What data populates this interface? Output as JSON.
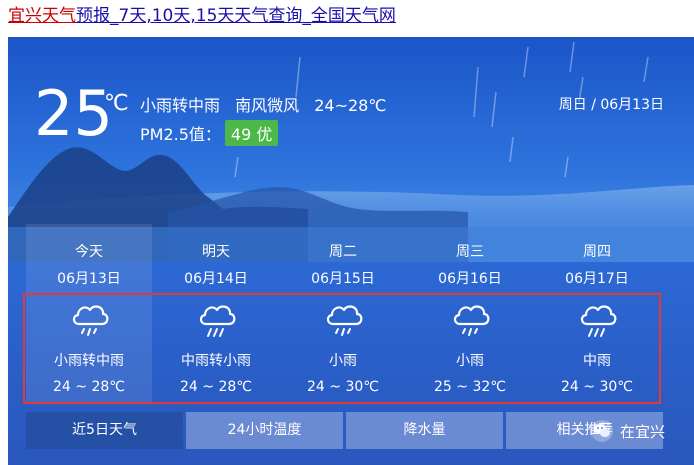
{
  "page_link": {
    "red_part": "宜兴天气",
    "blue_part": "预报_7天,10天,15天天气查询_全国天气网"
  },
  "current": {
    "temp": "25",
    "unit": "℃",
    "condition": "小雨转中雨",
    "wind": "南风微风",
    "range": "24~28℃",
    "pm_label": "PM2.5值：",
    "aqi": "49 优",
    "date": "周日 / 06月13日"
  },
  "forecast": [
    {
      "name": "今天",
      "date": "06月13日",
      "icon": "rain-cloud-icon",
      "condition": "小雨转中雨",
      "range": "24 ~ 28℃"
    },
    {
      "name": "明天",
      "date": "06月14日",
      "icon": "rain-cloud-icon",
      "condition": "中雨转小雨",
      "range": "24 ~ 28℃"
    },
    {
      "name": "周二",
      "date": "06月15日",
      "icon": "rain-cloud-icon",
      "condition": "小雨",
      "range": "24 ~ 30℃"
    },
    {
      "name": "周三",
      "date": "06月16日",
      "icon": "rain-cloud-icon",
      "condition": "小雨",
      "range": "25 ~ 32℃"
    },
    {
      "name": "周四",
      "date": "06月17日",
      "icon": "rain-cloud-icon",
      "condition": "中雨",
      "range": "24 ~ 30℃"
    }
  ],
  "tabs": [
    "近5日天气",
    "24小时温度",
    "降水量",
    "相关推荐"
  ],
  "watermark": "在宜兴",
  "colors": {
    "aqi_badge": "#4cb848",
    "highlight_border": "#e53935",
    "active_tab": "#2450a6"
  }
}
